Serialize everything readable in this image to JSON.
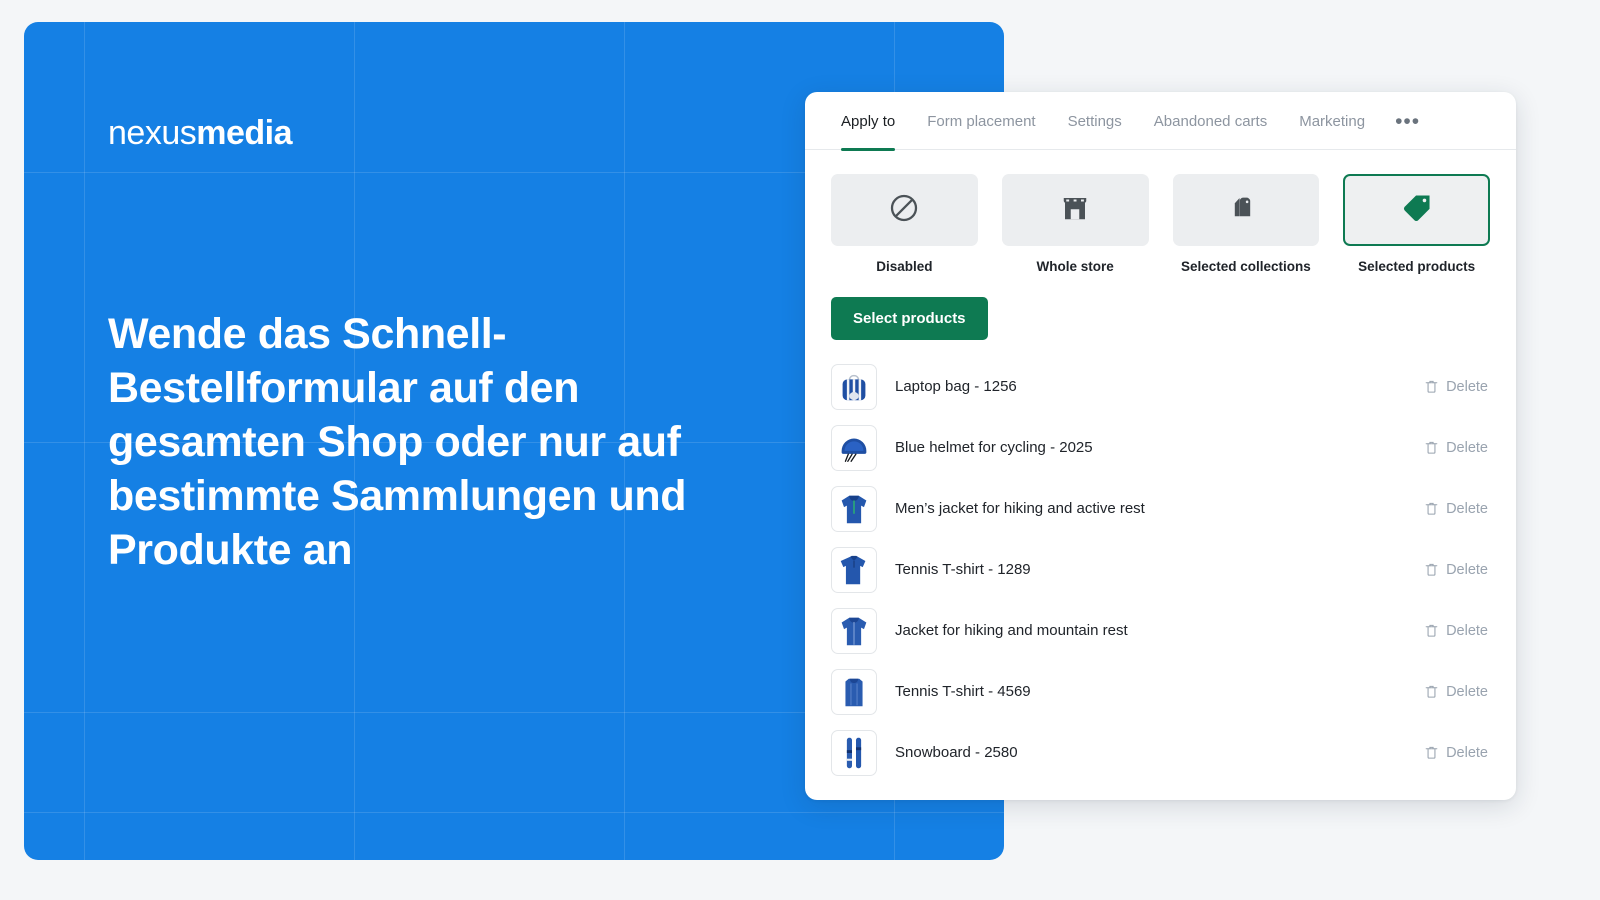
{
  "hero": {
    "logo_light": "nexus",
    "logo_bold": "media",
    "headline": "Wende das Schnell-Bestellformular auf den gesamten Shop oder nur auf bestimmte Sammlungen und Produkte an",
    "background_color": "#1580E4"
  },
  "card": {
    "tabs": [
      {
        "label": "Apply to",
        "active": true
      },
      {
        "label": "Form placement",
        "active": false
      },
      {
        "label": "Settings",
        "active": false
      },
      {
        "label": "Abandoned carts",
        "active": false
      },
      {
        "label": "Marketing",
        "active": false
      }
    ],
    "more_tabs_label": "•••",
    "accent_color": "#0E7A52",
    "apply_to_options": [
      {
        "label": "Disabled",
        "icon": "no-entry-icon",
        "selected": false
      },
      {
        "label": "Whole store",
        "icon": "storefront-icon",
        "selected": false
      },
      {
        "label": "Selected collections",
        "icon": "collections-tags-icon",
        "selected": false
      },
      {
        "label": "Selected products",
        "icon": "product-tag-icon",
        "selected": true
      }
    ],
    "select_products_button": "Select products",
    "delete_label": "Delete",
    "products": [
      {
        "name": "Laptop bag - 1256",
        "thumb": "backpack-thumb"
      },
      {
        "name": "Blue helmet for cycling - 2025",
        "thumb": "helmet-thumb"
      },
      {
        "name": "Men’s jacket for hiking and active rest",
        "thumb": "hoodie-thumb"
      },
      {
        "name": "Tennis T-shirt - 1289",
        "thumb": "polo-thumb"
      },
      {
        "name": "Jacket for hiking and mountain rest",
        "thumb": "zip-jacket-thumb"
      },
      {
        "name": "Tennis T-shirt - 4569",
        "thumb": "tank-top-thumb"
      },
      {
        "name": "Snowboard - 2580",
        "thumb": "snowboard-thumb"
      }
    ]
  }
}
